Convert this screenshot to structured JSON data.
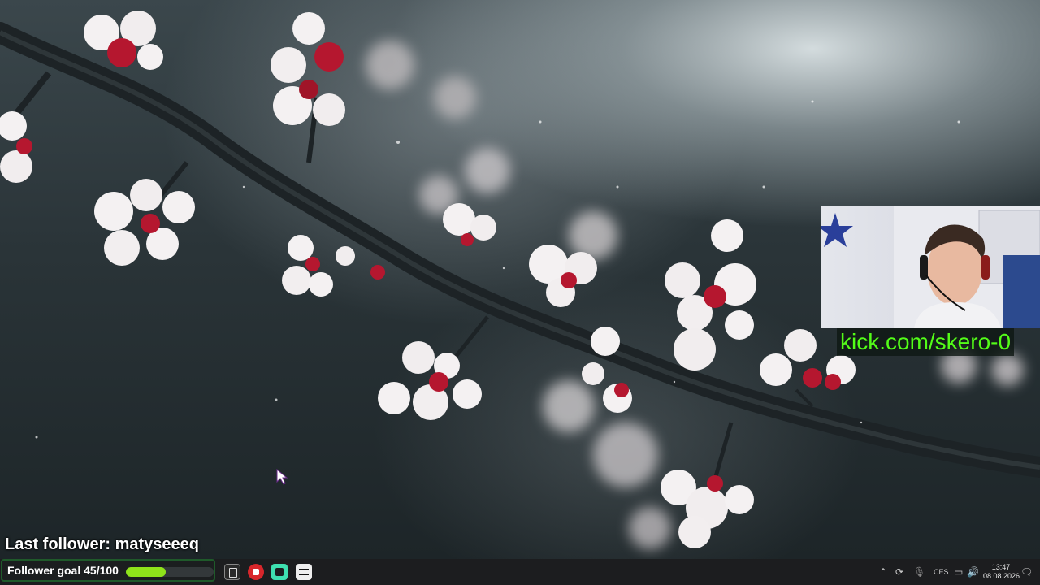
{
  "webcam_overlay": {
    "link_text": "kick.com/skero-0"
  },
  "stream_overlay": {
    "last_follower_text": "Last follower: matyseeeq",
    "follower_goal": {
      "label": "Follower goal 45/100",
      "current": 45,
      "target": 100,
      "progress_fraction": 0.45,
      "bar_color": "#8fe31a",
      "border_color": "#1f5a2a"
    }
  },
  "taskbar": {
    "pinned_apps": [
      {
        "name": "epic-games-icon"
      },
      {
        "name": "red-app-icon"
      },
      {
        "name": "green-app-icon"
      },
      {
        "name": "capcut-icon"
      }
    ],
    "tray": {
      "chevron_icon": "⌃",
      "sync_icon": "⟳",
      "mic_icon": "🎙",
      "language": "CES",
      "monitor_icon": "▭",
      "volume_icon": "🔊",
      "notification_icon": "🗨"
    },
    "clock": {
      "time": "13:47",
      "date": "08.08.2026"
    }
  },
  "colors": {
    "kick_green": "#53fc18",
    "taskbar_bg": "#1c1d1f",
    "blossom_white": "#f4f1f2",
    "blossom_red": "#b5172f"
  }
}
